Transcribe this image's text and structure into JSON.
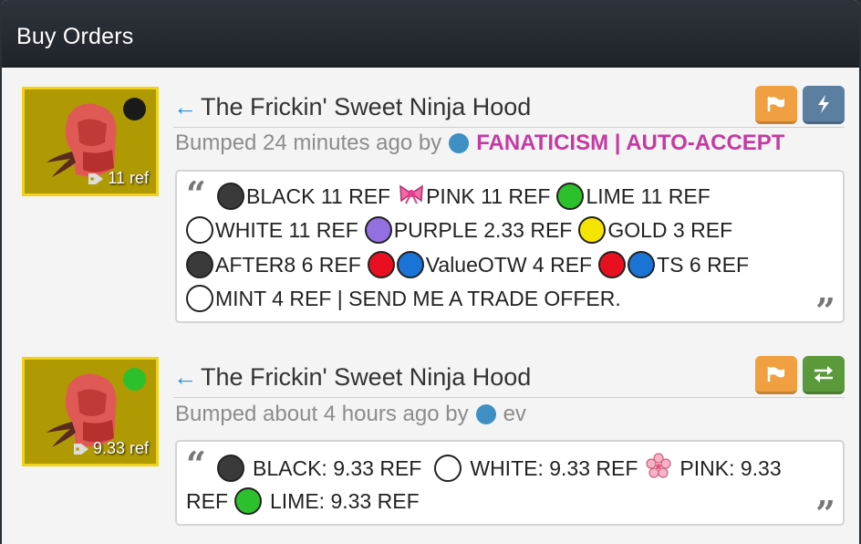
{
  "panel": {
    "title": "Buy Orders"
  },
  "colors": {
    "brand_header": "#1f2329",
    "thumb_bg": "#b09a04",
    "thumb_border": "#f1d21a",
    "flag_button": "#f0a040",
    "bolt_button": "#5b7fa0",
    "swap_button": "#5a9a3a",
    "user_highlight": "#c43aa3",
    "online": "#2dc02d",
    "offline": "#1a1a1a"
  },
  "listings": [
    {
      "price": "11 ref",
      "status": "offline",
      "item_name": "The Frickin' Sweet Ninja Hood",
      "bump_text": "Bumped 24 minutes ago by",
      "user": "FANATICISM | AUTO-ACCEPT",
      "buttons": [
        "flag-icon",
        "lightning-icon"
      ],
      "message": {
        "line1": [
          "BLACK 11 REF",
          "PINK 11 REF",
          "LIME 11 REF"
        ],
        "line2": [
          "WHITE 11 REF",
          "PURPLE 2.33 REF",
          "GOLD 3 REF"
        ],
        "line3": [
          "AFTER8 6 REF",
          "ValueOTW 4 REF",
          "TS 6 REF"
        ],
        "line4": [
          "MINT 4 REF | SEND ME A TRADE OFFER."
        ]
      }
    },
    {
      "price": "9.33 ref",
      "status": "online",
      "item_name": "The Frickin' Sweet Ninja Hood",
      "bump_text": "Bumped about 4 hours ago by",
      "user": "ev",
      "buttons": [
        "flag-icon",
        "swap-icon"
      ],
      "message": {
        "line1": [
          "BLACK: 9.33 REF",
          "WHITE: 9.33 REF",
          "PINK: 9.33"
        ],
        "line2": [
          "REF",
          "LIME: 9.33 REF"
        ]
      }
    }
  ]
}
